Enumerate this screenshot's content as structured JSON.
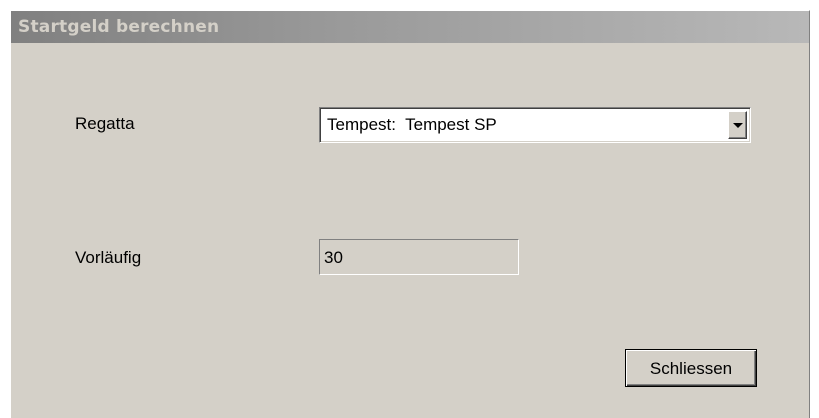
{
  "window": {
    "title": "Startgeld berechnen"
  },
  "form": {
    "regatta_label": "Regatta",
    "regatta_value": "Tempest:  Tempest SP",
    "vorlaeufig_label": "Vorläufig",
    "vorlaeufig_value": "30"
  },
  "buttons": {
    "close_label": "Schliessen"
  },
  "icons": {
    "dropdown": "chevron-down-icon"
  },
  "colors": {
    "window_bg": "#d4d0c8",
    "title_bar_start": "#808080",
    "title_bar_end": "#b8b8b8",
    "title_text": "#d4d0c8"
  }
}
